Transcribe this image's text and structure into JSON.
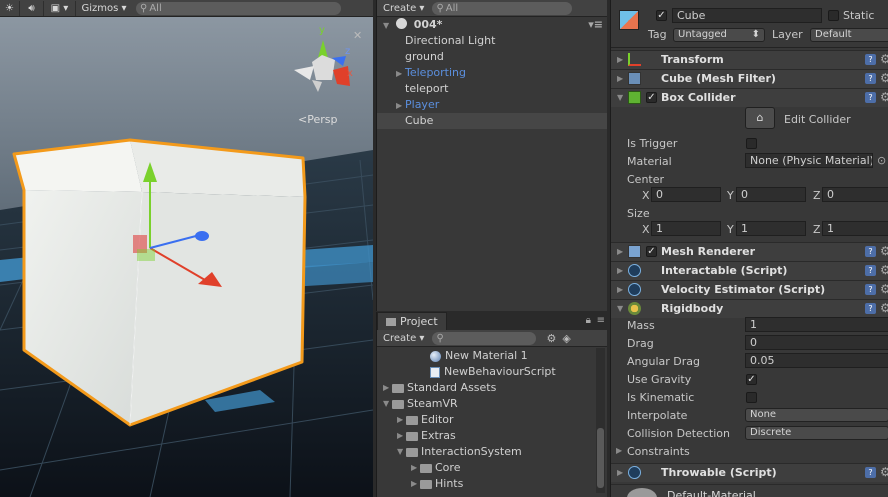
{
  "scene": {
    "toolbar": {
      "gizmos_label": "Gizmos",
      "search_placeholder": "All"
    },
    "persp_label": "Persp",
    "axis_labels": {
      "x": "x",
      "y": "y",
      "z": "z"
    }
  },
  "hierarchy": {
    "create_label": "Create",
    "search_placeholder": "All",
    "scene_name": "004*",
    "items": [
      {
        "label": "Directional Light",
        "style": "normal",
        "expandable": false,
        "selected": false
      },
      {
        "label": "ground",
        "style": "normal",
        "expandable": false,
        "selected": false
      },
      {
        "label": "Teleporting",
        "style": "prefab",
        "expandable": true,
        "selected": false
      },
      {
        "label": "teleport",
        "style": "normal",
        "expandable": false,
        "selected": false
      },
      {
        "label": "Player",
        "style": "prefab",
        "expandable": true,
        "selected": false
      },
      {
        "label": "Cube",
        "style": "normal",
        "expandable": false,
        "selected": true
      }
    ]
  },
  "project": {
    "tab_label": "Project",
    "create_label": "Create",
    "items": [
      {
        "label": "New Material 1",
        "kind": "material"
      },
      {
        "label": "NewBehaviourScript",
        "kind": "script"
      },
      {
        "label": "Standard Assets",
        "kind": "folder"
      },
      {
        "label": "SteamVR",
        "kind": "folder"
      },
      {
        "label": "Editor",
        "kind": "folder"
      },
      {
        "label": "Extras",
        "kind": "folder"
      },
      {
        "label": "InteractionSystem",
        "kind": "folder"
      },
      {
        "label": "Core",
        "kind": "folder"
      },
      {
        "label": "Hints",
        "kind": "folder"
      }
    ]
  },
  "inspector": {
    "object_name": "Cube",
    "static_label": "Static",
    "tag_label": "Tag",
    "tag_value": "Untagged",
    "layer_label": "Layer",
    "layer_value": "Default",
    "components": {
      "transform": "Transform",
      "mesh_filter": "Cube (Mesh Filter)",
      "box_collider": "Box Collider",
      "mesh_renderer": "Mesh Renderer",
      "interactable": "Interactable (Script)",
      "velocity": "Velocity Estimator (Script)",
      "rigidbody": "Rigidbody",
      "throwable": "Throwable (Script)"
    },
    "box_collider": {
      "edit_label": "Edit Collider",
      "is_trigger_label": "Is Trigger",
      "material_label": "Material",
      "material_value": "None (Physic Material)",
      "center_label": "Center",
      "center": {
        "x": "0",
        "y": "0",
        "z": "0"
      },
      "size_label": "Size",
      "size": {
        "x": "1",
        "y": "1",
        "z": "1"
      }
    },
    "rigidbody": {
      "mass_label": "Mass",
      "mass": "1",
      "drag_label": "Drag",
      "drag": "0",
      "angular_drag_label": "Angular Drag",
      "angular_drag": "0.05",
      "use_gravity_label": "Use Gravity",
      "is_kinematic_label": "Is Kinematic",
      "interpolate_label": "Interpolate",
      "interpolate": "None",
      "collision_label": "Collision Detection",
      "collision": "Discrete",
      "constraints_label": "Constraints"
    },
    "axis": {
      "x": "X",
      "y": "Y",
      "z": "Z"
    },
    "material_footer": "Default-Material"
  },
  "colors": {
    "selection_orange": "#f39a1b",
    "prefab_blue": "#5b8fde",
    "grid_blue": "#3f8fc4"
  }
}
